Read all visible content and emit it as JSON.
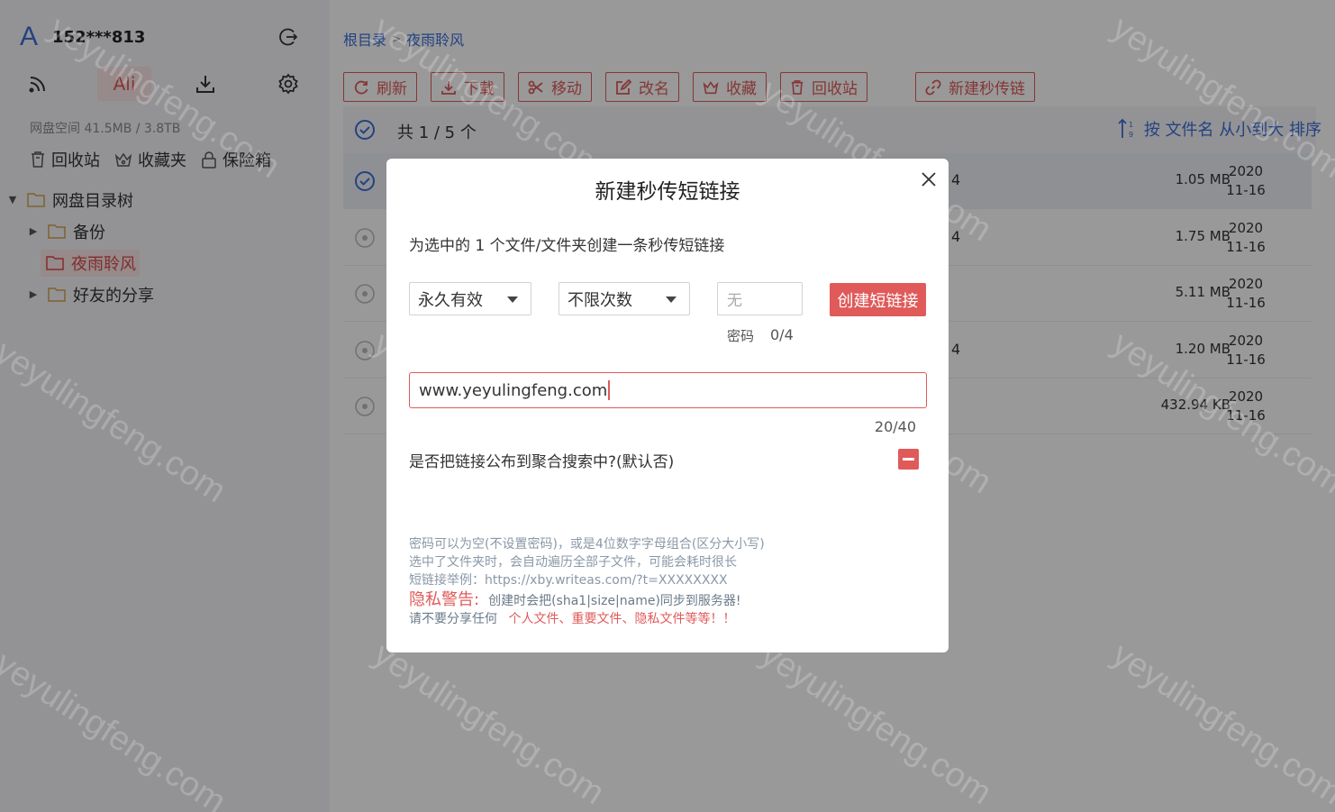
{
  "account": {
    "name": "152***813"
  },
  "sidebar": {
    "ali_tab": "Ali",
    "space": "网盘空间 41.5MB / 3.8TB",
    "quick": [
      {
        "label": "回收站"
      },
      {
        "label": "收藏夹"
      },
      {
        "label": "保险箱"
      }
    ],
    "tree": {
      "root": "网盘目录树",
      "children": [
        {
          "label": "备份"
        },
        {
          "label": "夜雨聆风"
        },
        {
          "label": "好友的分享"
        }
      ]
    }
  },
  "breadcrumb": {
    "root": "根目录",
    "sep": ">",
    "current": "夜雨聆风"
  },
  "toolbar": {
    "refresh": "刷新",
    "download": "下载",
    "move": "移动",
    "rename": "改名",
    "favorite": "收藏",
    "trash": "回收站",
    "new_link": "新建秒传链"
  },
  "list": {
    "count": "共 1 / 5 个",
    "sort": "按 文件名 从小到大 排序",
    "rows": [
      {
        "frag": "4",
        "size": "1.05 MB",
        "year": "2020",
        "date": "11-16"
      },
      {
        "frag": "4",
        "size": "1.75 MB",
        "year": "2020",
        "date": "11-16"
      },
      {
        "frag": "",
        "size": "5.11 MB",
        "year": "2020",
        "date": "11-16"
      },
      {
        "frag": "4",
        "size": "1.20 MB",
        "year": "2020",
        "date": "11-16"
      },
      {
        "frag": "",
        "size": "432.94 KB",
        "year": "2020",
        "date": "11-16"
      }
    ]
  },
  "modal": {
    "title": "新建秒传短链接",
    "description": "为选中的 1 个文件/文件夹创建一条秒传短链接",
    "expire_select": "永久有效",
    "times_select": "不限次数",
    "password_placeholder": "无",
    "password_label": "密码",
    "password_count": "0/4",
    "create_button": "创建短链接",
    "title_value": "www.yeyulingfeng.com",
    "title_count": "20/40",
    "publish_question": "是否把链接公布到聚合搜索中?(默认否)",
    "notes": {
      "line1": "密码可以为空(不设置密码)，或是4位数字字母组合(区分大小写)",
      "line2": "选中了文件夹时，会自动遍历全部子文件，可能会耗时很长",
      "line3": "短链接举例：https://xby.writeas.com/?t=XXXXXXXX",
      "warn_title": "隐私警告:",
      "warn_body": "创建时会把(sha1|size|name)同步到服务器!",
      "line5_prefix": "请不要分享任何",
      "line5_red": "个人文件、重要文件、隐私文件等等！！"
    }
  },
  "watermark": "yeyulingfeng.com",
  "colors": {
    "accent": "#e05a5a",
    "link": "#3b6fd8"
  }
}
